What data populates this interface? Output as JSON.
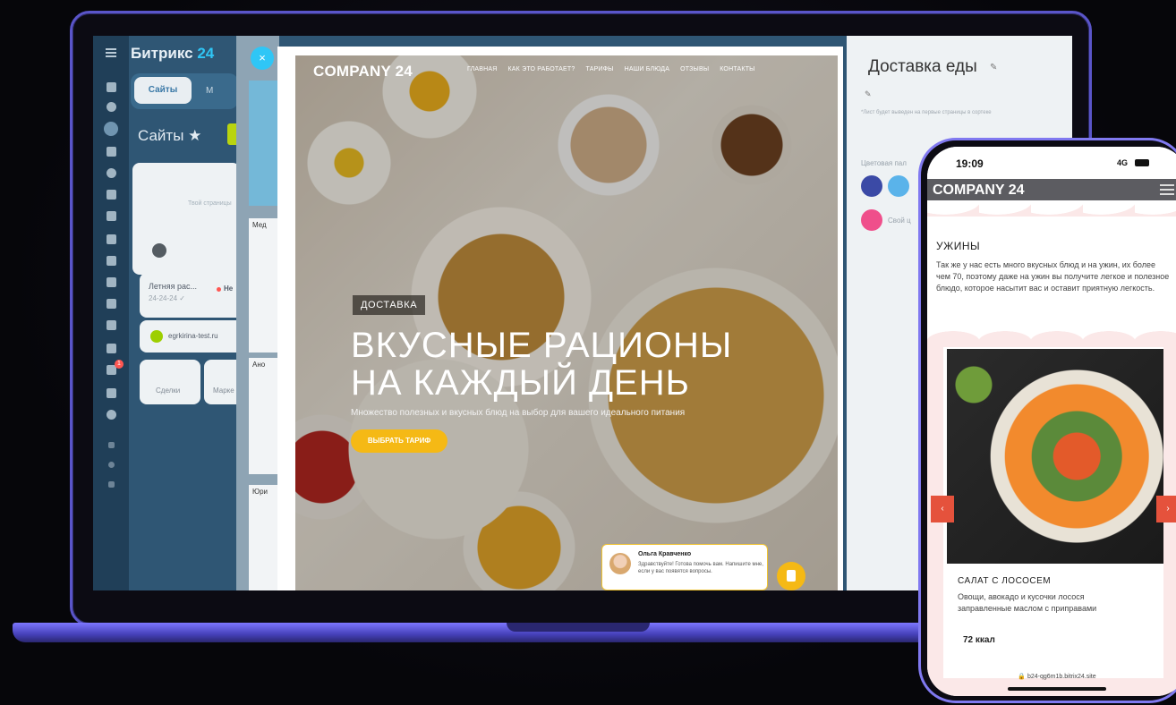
{
  "brand": {
    "name": "Битрикс",
    "num": "24"
  },
  "crm": {
    "tab_active": "Сайты",
    "tab_second": "М",
    "sites_title": "Сайты ★",
    "card_placeholder": "Твой страницы",
    "site_name": "Летняя рас...",
    "site_date": "24-24-24 ✓",
    "site_status": "Не",
    "site_domain": "egrkirina-test.ru",
    "btn_deals": "Сделки",
    "btn_market": "Марке",
    "rail_badge": "1"
  },
  "slider_col": {
    "items": [
      "Мед",
      "Ано",
      "Юри"
    ]
  },
  "close_label": "×",
  "site": {
    "logo": "COMPANY 24",
    "nav": [
      "ГЛАВНАЯ",
      "КАК ЭТО РАБОТАЕТ?",
      "ТАРИФЫ",
      "НАШИ БЛЮДА",
      "ОТЗЫВЫ",
      "КОНТАКТЫ"
    ],
    "badge": "ДОСТАВКА",
    "hero_line1": "ВКУСНЫЕ РАЦИОНЫ",
    "hero_line2": "НА КАЖДЫЙ ДЕНЬ",
    "hero_sub": "Множество полезных и вкусных блюд на выбор для вашего идеального питания",
    "cta": "ВЫБРАТЬ ТАРИФ"
  },
  "chat": {
    "name": "Ольга Кравченко",
    "message": "Здравствуйте! Готова помочь вам. Напишите мне, если у вас появятся вопросы."
  },
  "panel": {
    "title": "Доставка еды",
    "pen": "✎",
    "note": "*Лист будет выведен на первые страницы в сортеке",
    "palette_label": "Цветовая пал",
    "own_label": "Свой ц",
    "colors": [
      "#3b4aa6",
      "#5ab3ea",
      "#ef4f8b"
    ]
  },
  "phone": {
    "time": "19:09",
    "network": "4G",
    "logo": "COMPANY 24",
    "section_title": "УЖИНЫ",
    "section_text": "Так же у нас есть много вкусных блюд и на ужин, их более чем 70, поэтому даже на ужин вы получите легкое и полезное блюдо, которое насытит вас и оставит приятную легкость.",
    "dish_title": "САЛАТ С ЛОСОСЕМ",
    "dish_desc": "Овощи, авокадо и кусочки лосося заправленные маслом с приправами",
    "dish_kcal": "72 ккал",
    "url": "🔒 b24-qg6m1b.bitrix24.site",
    "arrow_left": "‹",
    "arrow_right": "›"
  }
}
